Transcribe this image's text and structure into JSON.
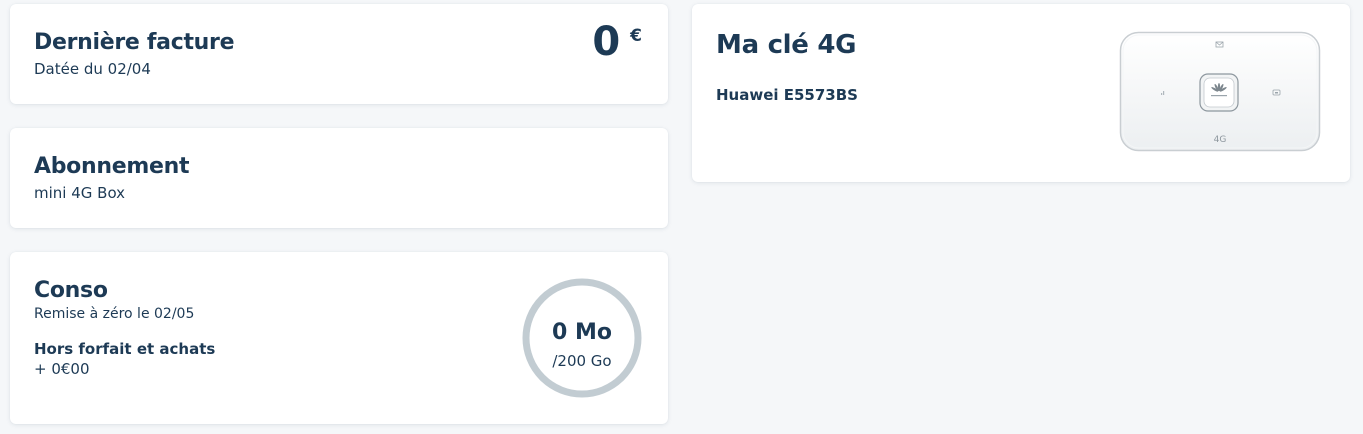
{
  "facture": {
    "title": "Dernière facture",
    "date": "Datée du 02/04",
    "amount": "0",
    "currency": "€"
  },
  "abonnement": {
    "title": "Abonnement",
    "plan": "mini 4G Box"
  },
  "conso": {
    "title": "Conso",
    "reset": "Remise à zéro le 02/05",
    "hors_forfait_label": "Hors forfait et achats",
    "hors_forfait_value": "+ 0€00",
    "used": "0 Mo",
    "total": "/200 Go",
    "usage_fraction": 0,
    "ring_color": "#c2ccd2"
  },
  "cle": {
    "title": "Ma clé 4G",
    "device_name": "Huawei E5573BS",
    "device_icon": "huawei-4g-router-icon",
    "device_badge": "4G"
  },
  "colors": {
    "text": "#1d3a55",
    "background": "#f5f7f9",
    "card": "#ffffff"
  }
}
